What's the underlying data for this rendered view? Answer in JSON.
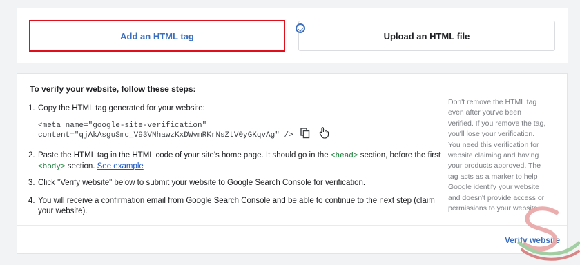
{
  "tabs": {
    "html_tag": "Add an HTML tag",
    "html_file": "Upload an HTML file"
  },
  "steps": {
    "title": "To verify your website, follow these steps:",
    "s1_num": "1.",
    "s1_text": "Copy the HTML tag generated for your website:",
    "code_line1": "<meta name=\"google-site-verification\"",
    "code_line2": "content=\"qjAkAsguSmc_V93VNhawzKxDWvmRKrNsZtV0yGKqvAg\" />",
    "s2_num": "2.",
    "s2_a": "Paste the HTML tag in the HTML code of your site's home page. It should go in the ",
    "s2_head": "<head>",
    "s2_b": " section, before the first",
    "s2_body": "<body>",
    "s2_c": " section. ",
    "s2_link": "See example",
    "s3_num": "3.",
    "s3_text": "Click \"Verify website\" below to submit your website to Google Search Console for verification.",
    "s4_num": "4.",
    "s4_text": "You will receive a confirmation email from Google Search Console and be able to continue to the next step (claim your website)."
  },
  "side_note": "Don't remove the HTML tag even after you've been verified. If you remove the tag, you'll lose your verification. You need this verification for website claiming and having your products approved. The tag acts as a marker to help Google identify your website and doesn't provide access or permissions to your website.",
  "verify_button": "Verify website",
  "icons": {
    "copy": "copy-icon",
    "hand_cursor": "hand-pointer-icon",
    "tab_cursor": "circle-check-cursor-icon"
  },
  "colors": {
    "accent": "#3c6fbf",
    "highlight_border": "#e10f1a",
    "tag_green": "#188038",
    "link": "#1a56c9"
  }
}
